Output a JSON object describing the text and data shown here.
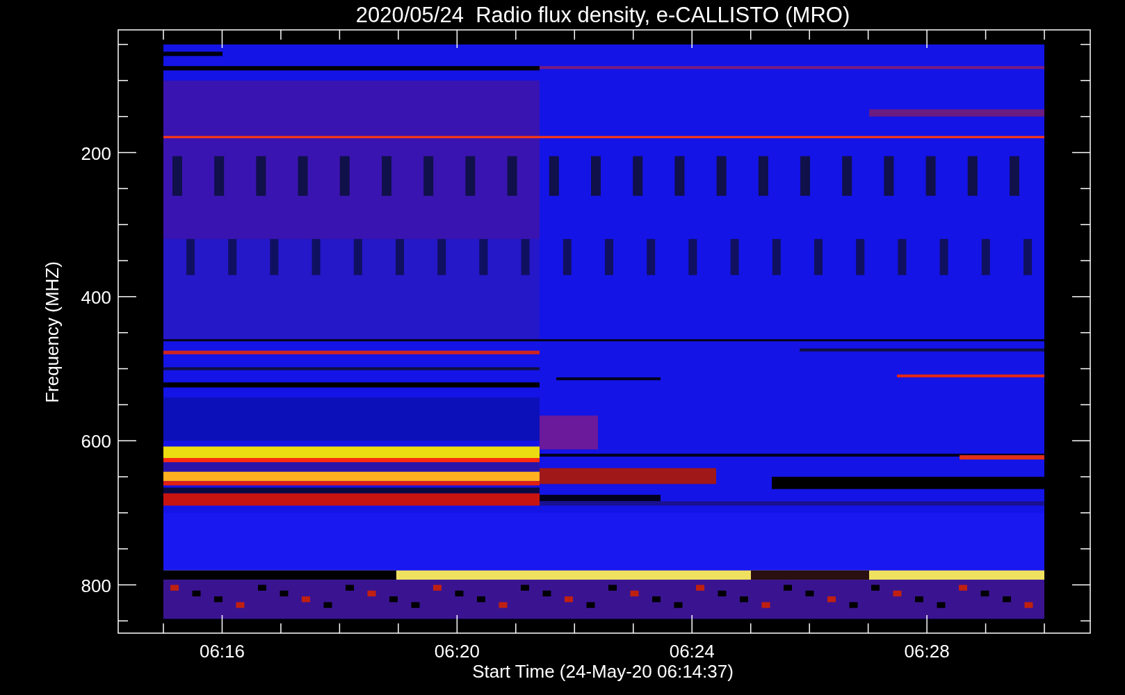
{
  "title": "2020/05/24  Radio flux density, e-CALLISTO (MRO)",
  "y_axis": {
    "label": "Frequency (MHZ)",
    "ticks": [
      "200",
      "400",
      "600",
      "800"
    ]
  },
  "x_axis": {
    "label": "Start Time (24-May-20 06:14:37)",
    "ticks": [
      "06:16",
      "06:20",
      "06:24",
      "06:28"
    ]
  }
}
